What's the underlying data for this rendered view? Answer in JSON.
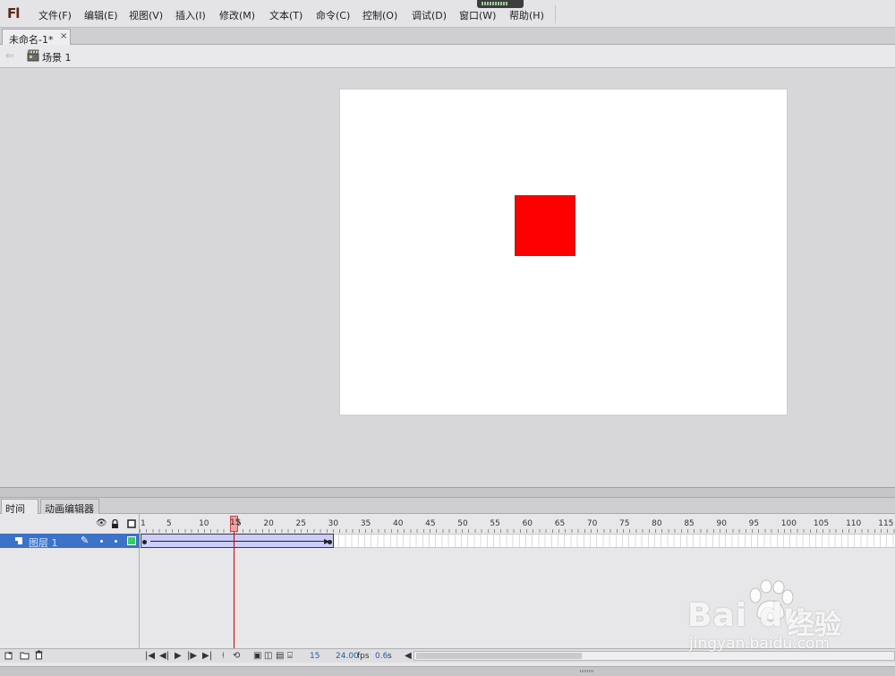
{
  "app": {
    "logo": "Fl"
  },
  "menu": [
    "文件(F)",
    "编辑(E)",
    "视图(V)",
    "插入(I)",
    "修改(M)",
    "文本(T)",
    "命令(C)",
    "控制(O)",
    "调试(D)",
    "窗口(W)",
    "帮助(H)"
  ],
  "document_tab": {
    "label": "未命名-1*",
    "close": "×"
  },
  "scene": {
    "back": "⇐",
    "label": "场景 1"
  },
  "panel_tabs": {
    "timeline": "时间轴",
    "motion_editor": "动画编辑器"
  },
  "layer": {
    "name": "图层 1",
    "color": "#33cc66"
  },
  "stage": {
    "background": "#ffffff",
    "shape_color": "#ff0000"
  },
  "frame_ruler": {
    "labels": [
      "1",
      "5",
      "10",
      "15",
      "20",
      "25",
      "30",
      "35",
      "40",
      "45",
      "50",
      "55",
      "60",
      "65",
      "70",
      "75",
      "80",
      "85",
      "90",
      "95",
      "100",
      "105",
      "110",
      "115"
    ]
  },
  "timeline": {
    "current_frame": "15",
    "tween_start_frame": 1,
    "tween_end_frame": 30,
    "frame_rate": "24.00",
    "frame_rate_unit": "fps",
    "elapsed": "0.6",
    "elapsed_unit": "s"
  },
  "watermark": {
    "brand": "Bai du",
    "product": "经验",
    "url": "jingyan.baidu.com"
  }
}
